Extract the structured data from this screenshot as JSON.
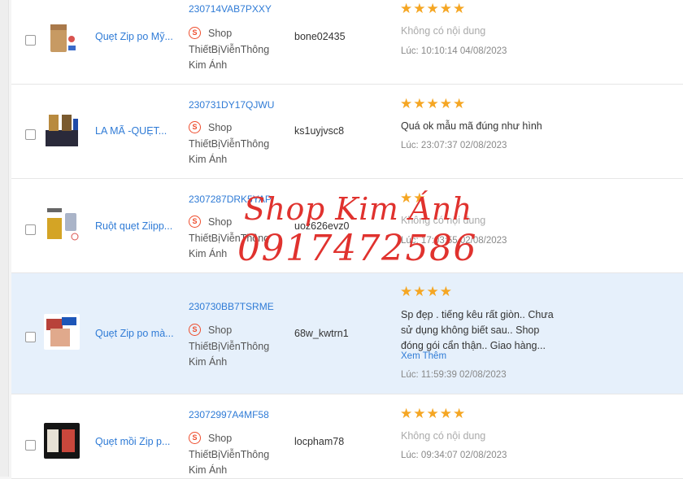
{
  "colors": {
    "link": "#2f7bd6",
    "star": "#f5a623",
    "shop_icon": "#ee4d2d",
    "watermark": "#e0322e",
    "selected_row": "#e6f0fb"
  },
  "icons": {
    "shop": "shopee-bag-icon",
    "star": "star-icon"
  },
  "rows": [
    {
      "product_name": "Quẹt Zip po Mỹ...",
      "order_id": "230714VAB7PXXY",
      "shop_label": "Shop",
      "shop_name_1": "ThiếtBịViễnThông",
      "shop_name_2": "Kim Ánh",
      "buyer": "bone02435",
      "rating": 5,
      "stars": "★★★★★",
      "review": "Không có nội dung",
      "time": "Lúc: 10:10:14 04/08/2023"
    },
    {
      "product_name": "LA MÃ -QUẸT...",
      "order_id": "230731DY17QJWU",
      "shop_label": "Shop",
      "shop_name_1": "ThiếtBịViễnThông",
      "shop_name_2": "Kim Ánh",
      "buyer": "ks1uyjvsc8",
      "rating": 5,
      "stars": "★★★★★",
      "review": "Quá ok mẫu mã đúng như hình",
      "time": "Lúc: 23:07:37 02/08/2023"
    },
    {
      "product_name": "Ruột quẹt Ziipp...",
      "order_id": "2307287DRK5YAP",
      "shop_label": "Shop",
      "shop_name_1": "ThiếtBịViễnThông",
      "shop_name_2": "Kim Ánh",
      "buyer": "uoz626evz0",
      "rating": 2,
      "stars": "★★",
      "review": "Không có nội dung",
      "time": "Lúc: 17:03:55 02/08/2023"
    },
    {
      "product_name": "Quẹt Zip po mà...",
      "order_id": "230730BB7TSRME",
      "shop_label": "Shop",
      "shop_name_1": "ThiếtBịViễnThông",
      "shop_name_2": "Kim Ánh",
      "buyer": "68w_kwtrn1",
      "rating": 4,
      "stars": "★★★★",
      "review": "Sp đẹp . tiếng kêu rất giòn.. Chưa sử dụng không biết sau.. Shop đóng gói cẩn thận.. Giao hàng...",
      "more": "Xem Thêm",
      "time": "Lúc: 11:59:39 02/08/2023"
    },
    {
      "product_name": "Quẹt mồi Zip p...",
      "order_id": "23072997A4MF58",
      "shop_label": "Shop",
      "shop_name_1": "ThiếtBịViễnThông",
      "shop_name_2": "Kim Ánh",
      "buyer": "locpham78",
      "rating": 5,
      "stars": "★★★★★",
      "review": "Không có nội dung",
      "time": "Lúc: 09:34:07 02/08/2023"
    }
  ],
  "watermark": {
    "line1": "Shop Kim Ánh",
    "line2": "0917472586"
  }
}
